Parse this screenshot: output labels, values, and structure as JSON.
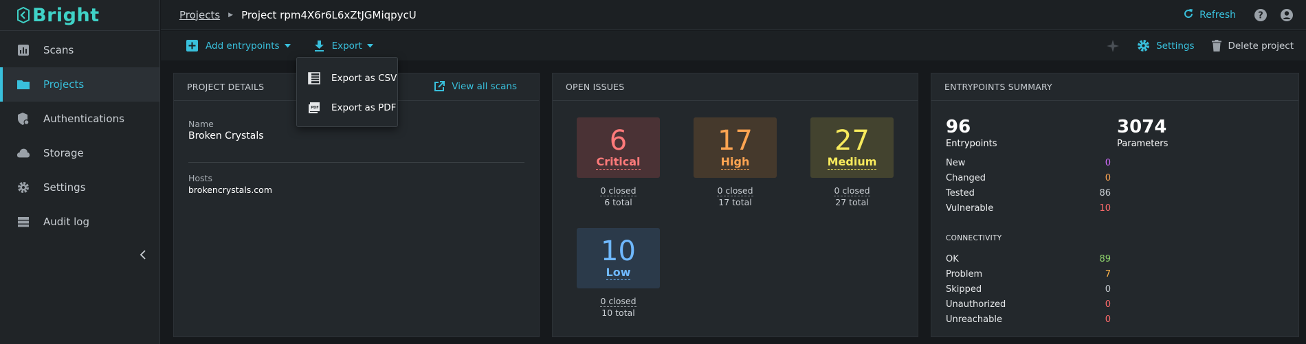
{
  "app": {
    "name": "Bright",
    "brand_color": "#3fd2c7",
    "accent_color": "#39c0dc"
  },
  "sidebar": {
    "items": [
      {
        "label": "Scans",
        "icon": "bar-chart-icon",
        "active": false
      },
      {
        "label": "Projects",
        "icon": "folder-icon",
        "active": true
      },
      {
        "label": "Authentications",
        "icon": "shield-lock-icon",
        "active": false
      },
      {
        "label": "Storage",
        "icon": "cloud-icon",
        "active": false
      },
      {
        "label": "Settings",
        "icon": "gear-icon",
        "active": false
      },
      {
        "label": "Audit log",
        "icon": "list-icon",
        "active": false
      }
    ]
  },
  "header": {
    "breadcrumb_root": "Projects",
    "breadcrumb_current": "Project rpm4X6r6L6xZtJGMiqpycU",
    "refresh_label": "Refresh"
  },
  "toolbar": {
    "add_entrypoints_label": "Add entrypoints",
    "export_label": "Export",
    "settings_label": "Settings",
    "delete_label": "Delete project"
  },
  "export_menu": {
    "items": [
      {
        "label": "Export as CSV",
        "icon": "table-icon"
      },
      {
        "label": "Export as PDF",
        "icon": "pdf-icon"
      }
    ]
  },
  "project_details": {
    "title": "PROJECT DETAILS",
    "view_all_label": "View all scans",
    "name_label": "Name",
    "name_value": "Broken Crystals",
    "hosts_label": "Hosts",
    "hosts_value": "brokencrystals.com"
  },
  "open_issues": {
    "title": "OPEN ISSUES",
    "severities": [
      {
        "count": "6",
        "label": "Critical",
        "closed": "0 closed",
        "total": "6 total",
        "color": "#ff7a7a",
        "bg": "#4a3235"
      },
      {
        "count": "17",
        "label": "High",
        "closed": "0 closed",
        "total": "17 total",
        "color": "#ffa552",
        "bg": "#45392c"
      },
      {
        "count": "27",
        "label": "Medium",
        "closed": "0 closed",
        "total": "27 total",
        "color": "#f7ea5c",
        "bg": "#43432f"
      },
      {
        "count": "10",
        "label": "Low",
        "closed": "0 closed",
        "total": "10 total",
        "color": "#6fb8ff",
        "bg": "#2b3a4a"
      }
    ]
  },
  "entrypoints_summary": {
    "title": "ENTRYPOINTS SUMMARY",
    "entrypoints_count": "96",
    "entrypoints_label": "Entrypoints",
    "parameters_count": "3074",
    "parameters_label": "Parameters",
    "stats": [
      {
        "label": "New",
        "value": "0",
        "color": "#d36cff"
      },
      {
        "label": "Changed",
        "value": "0",
        "color": "#ffa552"
      },
      {
        "label": "Tested",
        "value": "86",
        "color": "#c9ced3"
      },
      {
        "label": "Vulnerable",
        "value": "10",
        "color": "#ff6b6b"
      }
    ],
    "connectivity_title": "CONNECTIVITY",
    "connectivity": [
      {
        "label": "OK",
        "value": "89",
        "color": "#8ed36c"
      },
      {
        "label": "Problem",
        "value": "7",
        "color": "#ffb44a"
      },
      {
        "label": "Skipped",
        "value": "0",
        "color": "#c9ced3"
      },
      {
        "label": "Unauthorized",
        "value": "0",
        "color": "#ff6b6b"
      },
      {
        "label": "Unreachable",
        "value": "0",
        "color": "#ff6b6b"
      }
    ]
  }
}
